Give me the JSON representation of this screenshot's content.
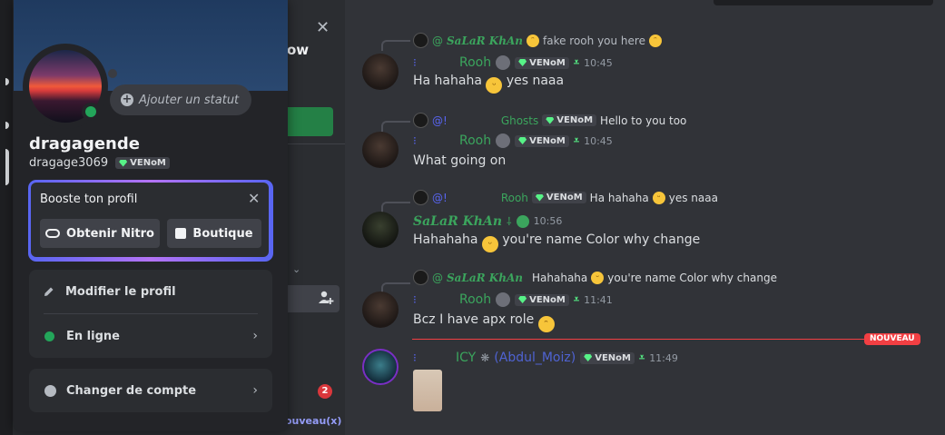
{
  "channel_sidebar": {
    "header_fragment": "ow",
    "badge_count": "2",
    "new_label": "ouveau(x)"
  },
  "chat": {
    "new_divider": "NOUVEAU",
    "messages": [
      {
        "reply": {
          "name": "SaLaR KhAn",
          "text": "fake rooh you here"
        },
        "author": "Rooh",
        "tag": "VENoM",
        "time": "10:45",
        "text": "Ha hahaha",
        "text_after": "yes naaa"
      },
      {
        "reply": {
          "name": "Ghosts",
          "tag": "VENoM",
          "text": "Hello to you too"
        },
        "author": "Rooh",
        "tag": "VENoM",
        "time": "10:45",
        "text": "What going on"
      },
      {
        "reply": {
          "name": "Rooh",
          "tag": "VENoM",
          "text": "Ha hahaha",
          "text_after": "yes naaa"
        },
        "author": "SaLaR KhAn",
        "time": "10:56",
        "text": "Hahahaha",
        "text_after": "you're name Color why change"
      },
      {
        "reply": {
          "name": "SaLaR KhAn",
          "text": "Hahahaha",
          "text_after": "you're name Color why change"
        },
        "author": "Rooh",
        "tag": "VENoM",
        "time": "11:41",
        "text": "Bcz  I have apx role"
      },
      {
        "author": "ICY",
        "author_extra": "(Abdul_Moiz)",
        "tag": "VENoM",
        "time": "11:49"
      }
    ]
  },
  "profile": {
    "status_placeholder": "Ajouter un statut",
    "display_name": "dragagende",
    "username": "dragage3069",
    "tag": "VENoM",
    "boost": {
      "title": "Booste ton profil",
      "nitro_button": "Obtenir Nitro",
      "shop_button": "Boutique"
    },
    "menu": {
      "edit_profile": "Modifier le profil",
      "status": "En ligne",
      "switch_account": "Changer de compte"
    }
  },
  "colors": {
    "online": "#23a55a",
    "new_divider": "#f23f43",
    "role_green": "#3ba55d"
  }
}
